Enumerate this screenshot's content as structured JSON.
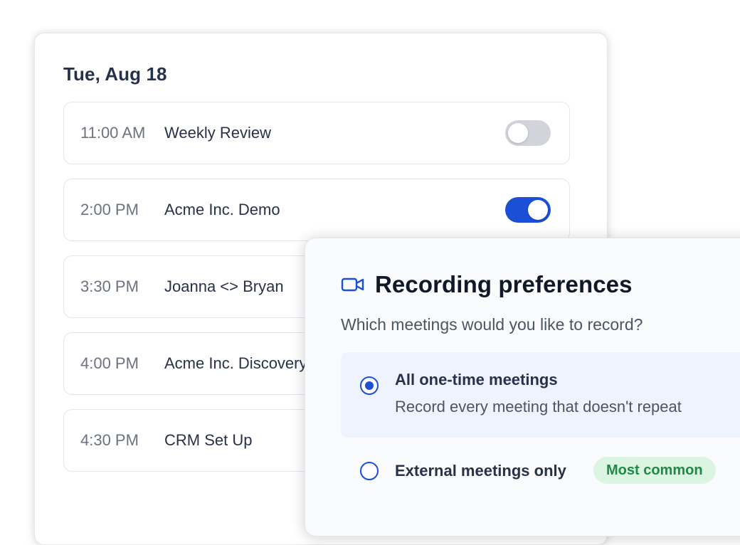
{
  "calendar": {
    "date": "Tue, Aug 18",
    "meetings": [
      {
        "time": "11:00 AM",
        "title": "Weekly Review",
        "record": false
      },
      {
        "time": "2:00 PM",
        "title": "Acme Inc. Demo",
        "record": true
      },
      {
        "time": "3:30 PM",
        "title": "Joanna <> Bryan",
        "record": null
      },
      {
        "time": "4:00 PM",
        "title": "Acme Inc. Discovery",
        "record": null
      },
      {
        "time": "4:30 PM",
        "title": "CRM Set Up",
        "record": null
      }
    ]
  },
  "preferences": {
    "icon": "video-camera-icon",
    "title": "Recording preferences",
    "question": "Which meetings would you like to record?",
    "options": [
      {
        "label": "All one-time meetings",
        "description": "Record every meeting that doesn't repeat",
        "selected": true
      },
      {
        "label": "External meetings only",
        "badge": "Most common",
        "selected": false
      }
    ]
  },
  "colors": {
    "accent": "#1a4fd6",
    "toggle_off": "#d1d5db",
    "selected_option_bg": "#eef3fd",
    "badge_bg": "#dcf5e3",
    "badge_text": "#1e8a45"
  }
}
